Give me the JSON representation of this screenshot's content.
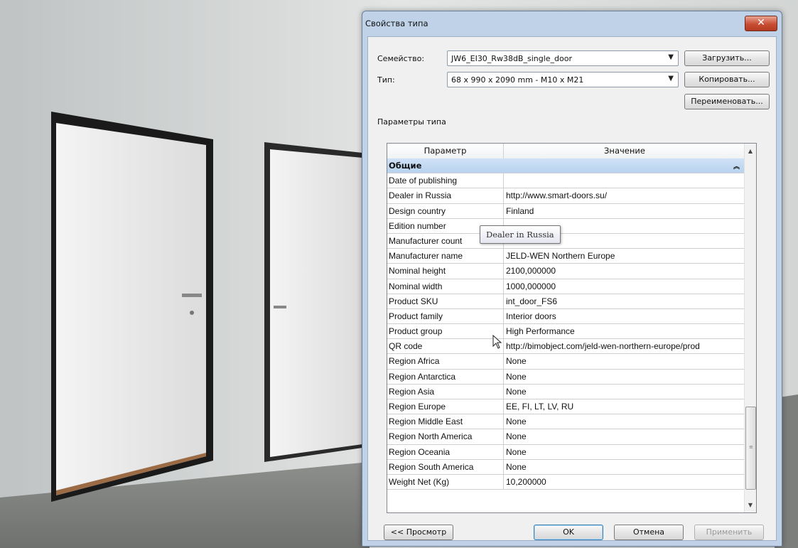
{
  "dialog": {
    "title": "Свойства типа",
    "close_label": "✕"
  },
  "family": {
    "label": "Семейство:",
    "value": "JW6_EI30_Rw38dB_single_door",
    "load_button": "Загрузить..."
  },
  "type": {
    "label": "Тип:",
    "value": "68 x 990 x 2090 mm - M10 x M21",
    "copy_button": "Копировать...",
    "rename_button": "Переименовать..."
  },
  "params_label": "Параметры типа",
  "table": {
    "headers": [
      "Параметр",
      "Значение"
    ],
    "group": "Общие",
    "rows": [
      {
        "name": "Date of publishing",
        "value": ""
      },
      {
        "name": "Dealer in Russia",
        "value": "http://www.smart-doors.su/"
      },
      {
        "name": "Design country",
        "value": "Finland"
      },
      {
        "name": "Edition number",
        "value": ""
      },
      {
        "name": "Manufacturer count",
        "value": ""
      },
      {
        "name": "Manufacturer name",
        "value": "JELD-WEN Northern Europe"
      },
      {
        "name": "Nominal height",
        "value": "2100,000000"
      },
      {
        "name": "Nominal width",
        "value": "1000,000000"
      },
      {
        "name": "Product SKU",
        "value": "int_door_FS6"
      },
      {
        "name": "Product family",
        "value": "Interior doors"
      },
      {
        "name": "Product group",
        "value": "High Performance"
      },
      {
        "name": "QR code",
        "value": "http://bimobject.com/jeld-wen-northern-europe/prod"
      },
      {
        "name": "Region Africa",
        "value": "None"
      },
      {
        "name": "Region Antarctica",
        "value": "None"
      },
      {
        "name": "Region Asia",
        "value": "None"
      },
      {
        "name": "Region Europe",
        "value": "EE, FI, LT, LV, RU"
      },
      {
        "name": "Region Middle East",
        "value": "None"
      },
      {
        "name": "Region North America",
        "value": "None"
      },
      {
        "name": "Region Oceania",
        "value": "None"
      },
      {
        "name": "Region South America",
        "value": "None"
      },
      {
        "name": "Weight Net (Kg)",
        "value": "10,200000"
      }
    ]
  },
  "tooltip": "Dealer in Russia",
  "footer": {
    "preview": "<< Просмотр",
    "ok": "OK",
    "cancel": "Отмена",
    "apply": "Применить"
  }
}
